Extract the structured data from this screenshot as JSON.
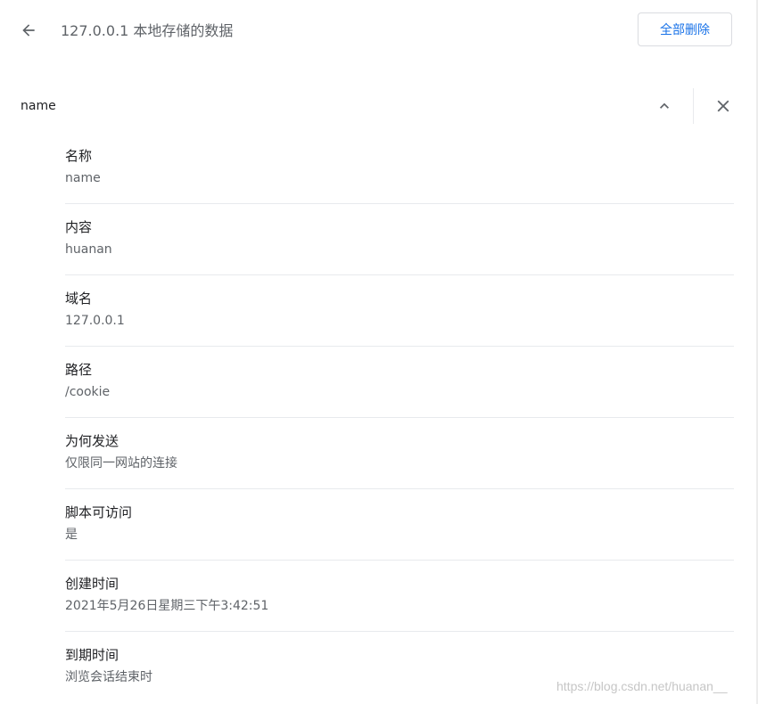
{
  "header": {
    "back_icon": "arrow-left-icon",
    "title": "127.0.0.1 本地存储的数据",
    "remove_all_label": "全部删除"
  },
  "cookie": {
    "name": "name",
    "collapse_icon": "chevron-up-icon",
    "delete_icon": "close-icon"
  },
  "details": [
    {
      "label": "名称",
      "value": "name"
    },
    {
      "label": "内容",
      "value": "huanan"
    },
    {
      "label": "域名",
      "value": "127.0.0.1"
    },
    {
      "label": "路径",
      "value": "/cookie"
    },
    {
      "label": "为何发送",
      "value": "仅限同一网站的连接"
    },
    {
      "label": "脚本可访问",
      "value": "是"
    },
    {
      "label": "创建时间",
      "value": "2021年5月26日星期三下午3:42:51"
    },
    {
      "label": "到期时间",
      "value": "浏览会话结束时"
    }
  ],
  "watermark": "https://blog.csdn.net/huanan__",
  "colors": {
    "accent": "#1a73e8",
    "text_primary": "#202124",
    "text_secondary": "#5f6368",
    "divider": "#e8eaed"
  }
}
